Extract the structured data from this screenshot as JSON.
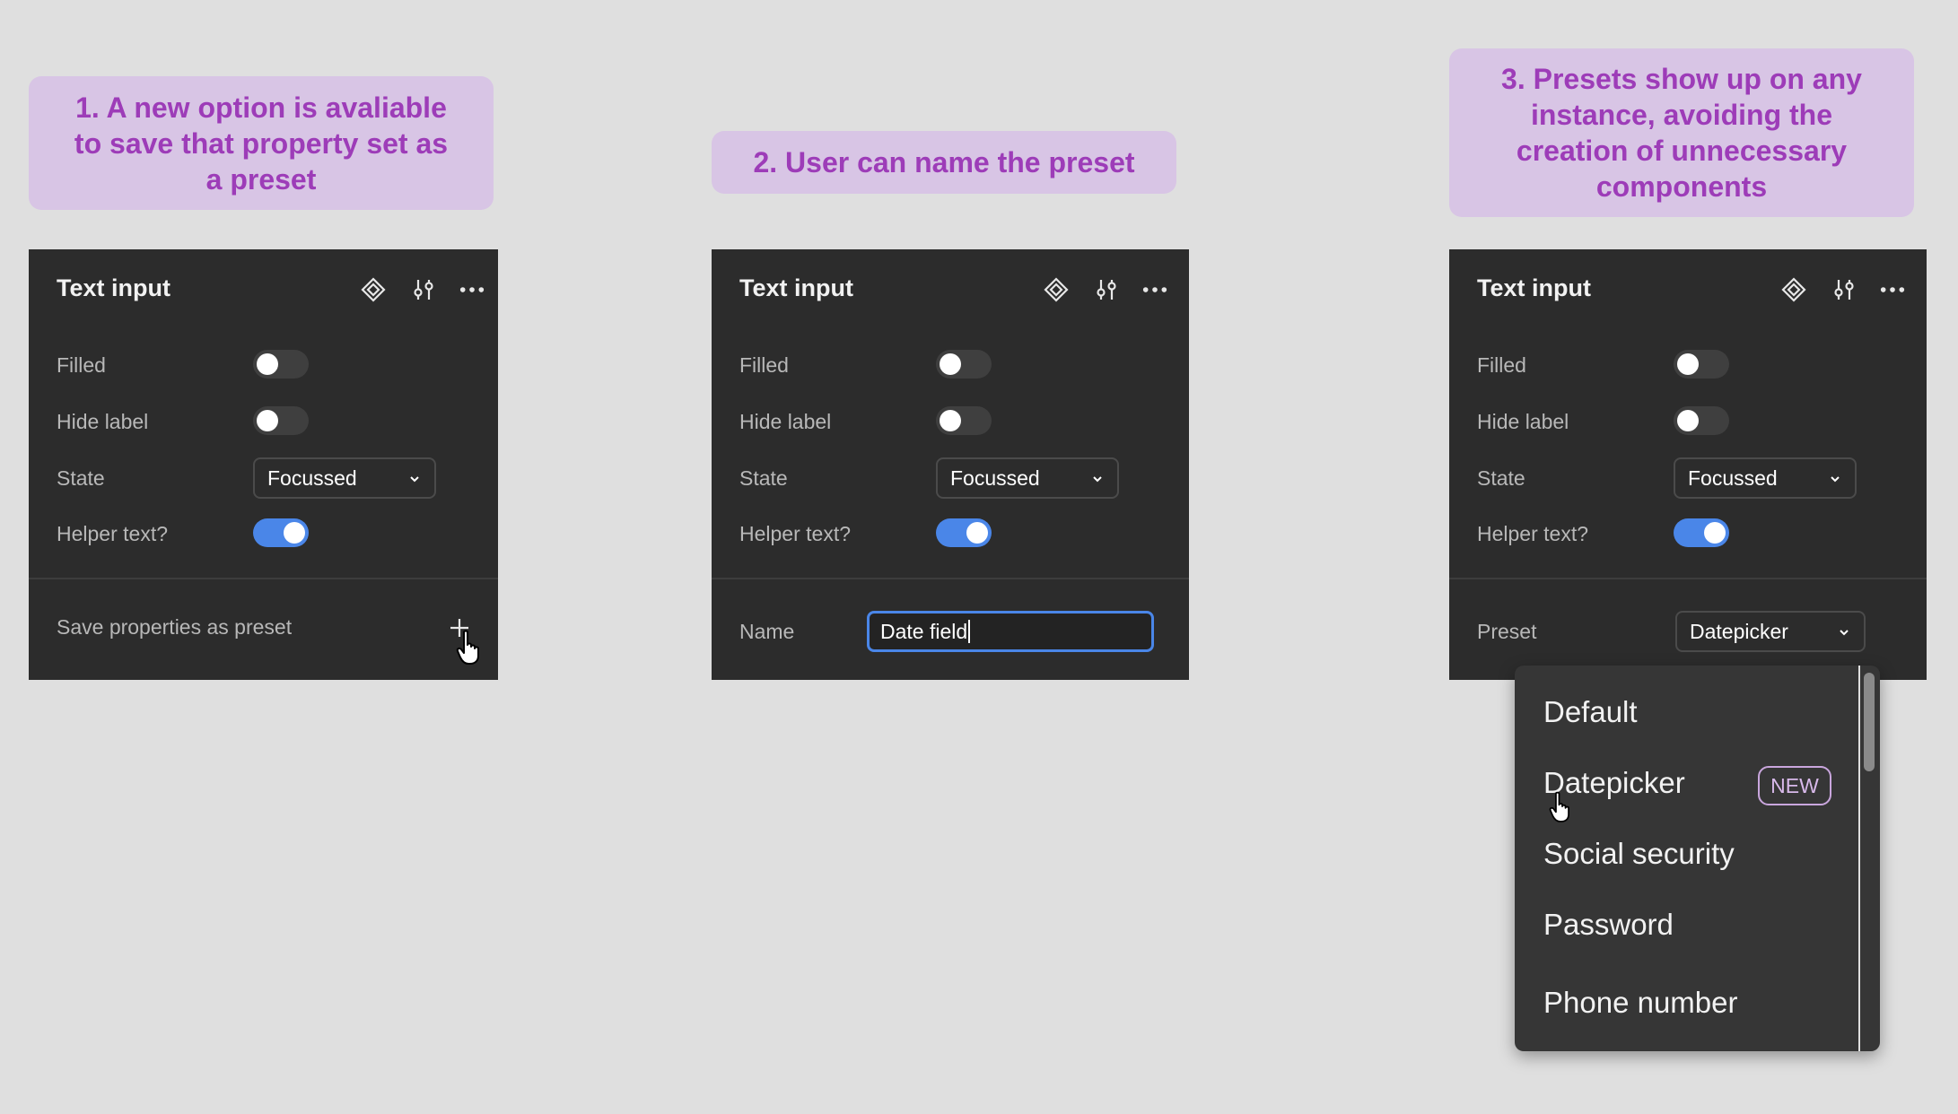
{
  "notes": {
    "one": [
      "1. A new option is avaliable",
      "to save that property set as",
      "a preset"
    ],
    "two": [
      "2. User can name the preset"
    ],
    "three": [
      "3. Presets show up on any",
      "instance, avoiding the",
      "creation of unnecessary",
      "components"
    ]
  },
  "panel": {
    "title": "Text input",
    "rows": {
      "filled": "Filled",
      "hide_label": "Hide label",
      "state": "State",
      "helper_text": "Helper text?"
    },
    "state_value": "Focussed",
    "toggles": {
      "filled": false,
      "hide_label": false,
      "helper_text": true
    },
    "icons": [
      "component-icon",
      "sliders-icon",
      "more-icon"
    ]
  },
  "step1": {
    "save_label": "Save properties as preset"
  },
  "step2": {
    "name_label": "Name",
    "name_value": "Date field"
  },
  "step3": {
    "preset_label": "Preset",
    "preset_value": "Datepicker",
    "options": [
      "Default",
      "Datepicker",
      "Social security",
      "Password",
      "Phone number"
    ],
    "new_badge": "NEW"
  },
  "colors": {
    "background": "#dfdfdf",
    "note_bg": "#d8c5e5",
    "note_text": "#9d3cb8",
    "panel_bg": "#2c2c2c",
    "toggle_on": "#4a86e8"
  }
}
